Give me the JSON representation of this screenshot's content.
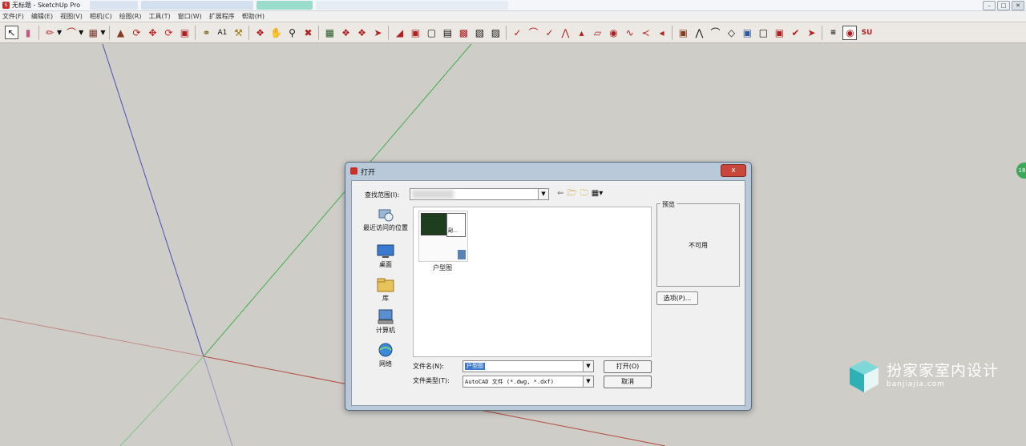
{
  "window": {
    "title": "无标题 - SketchUp Pro",
    "controls": [
      "minimize-icon",
      "restore-icon",
      "close-icon"
    ]
  },
  "menu": [
    "文件(F)",
    "编辑(E)",
    "视图(V)",
    "相机(C)",
    "绘图(R)",
    "工具(T)",
    "窗口(W)",
    "扩展程序",
    "帮助(H)"
  ],
  "toolbar_icons": [
    "select-icon",
    "eraser-icon",
    "line-icon",
    "arc-icon",
    "rectangle-icon",
    "push-pull-icon",
    "follow-me-icon",
    "move-icon",
    "rotate-icon",
    "scale-icon",
    "tape-measure-icon",
    "text-icon",
    "paint-bucket-icon",
    "orbit-icon",
    "pan-icon",
    "zoom-icon",
    "zoom-extents-icon",
    "components-icon",
    "materials-icon",
    "warehouse-icon",
    "share-icon",
    "section-plane-icon",
    "view-iso-icon",
    "view-top-icon",
    "view-front-icon",
    "view-right-icon",
    "view-back-icon",
    "view-left-icon",
    "sandbox-icon",
    "smoove-icon",
    "stamp-icon",
    "drape-icon",
    "add-detail-icon",
    "flip-edge-icon",
    "solid-union-icon",
    "solid-subtract-icon",
    "solid-trim-icon",
    "solid-split-icon",
    "outer-shell-icon",
    "intersect-icon",
    "x-ray-icon",
    "back-edges-icon",
    "wireframe-icon",
    "hidden-line-icon",
    "shaded-icon",
    "textured-icon",
    "monochrome-icon",
    "position-camera-icon",
    "look-around-icon",
    "walk-icon",
    "styles-icon",
    "su-logo-icon"
  ],
  "dialog": {
    "title": "打开",
    "close_label": "x",
    "look_in_label": "查找范围(I):",
    "places": [
      {
        "label": "最近访问的位置",
        "icon": "recent-places-icon"
      },
      {
        "label": "桌面",
        "icon": "desktop-icon"
      },
      {
        "label": "库",
        "icon": "library-icon"
      },
      {
        "label": "计算机",
        "icon": "computer-icon"
      },
      {
        "label": "网络",
        "icon": "network-icon"
      }
    ],
    "files": [
      {
        "name": "户型图",
        "thumb_label": "副..."
      }
    ],
    "preview_label": "预览",
    "preview_unavailable": "不可用",
    "options_label": "选项(P)...",
    "file_name_label": "文件名(N):",
    "file_name_value": "户型图",
    "file_type_label": "文件类型(T):",
    "file_type_value": "AutoCAD 文件 (*.dwg, *.dxf)",
    "open_label": "打开(O)",
    "cancel_label": "取消"
  },
  "watermark": {
    "text": "扮家家室内设计",
    "url": "banjiajia.com"
  },
  "side_badge": "18",
  "colors": {
    "canvas_bg": "#cfcdc8",
    "axis_blue": "#4a4fb5",
    "axis_green": "#3fae4a",
    "axis_red": "#b44a3f",
    "dialog_frame": "#b9c9da",
    "close_red": "#c9473a"
  }
}
